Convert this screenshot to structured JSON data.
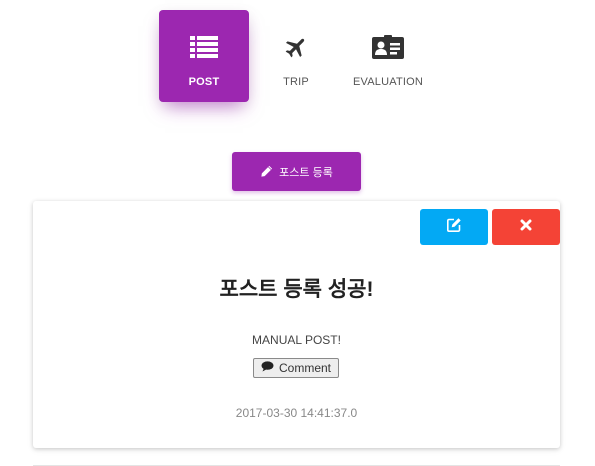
{
  "tabs": [
    {
      "label": "POST",
      "icon": "list-icon",
      "active": true
    },
    {
      "label": "TRIP",
      "icon": "airplane-icon",
      "active": false
    },
    {
      "label": "EVALUATION",
      "icon": "id-card-icon",
      "active": false
    }
  ],
  "register_button": {
    "label": "포스트 등록",
    "icon": "pencil-icon"
  },
  "post": {
    "title": "포스트 등록 성공!",
    "body": "MANUAL POST!",
    "comment_label": "Comment",
    "date": "2017-03-30 14:41:37.0",
    "edit_icon": "edit-icon",
    "delete_icon": "close-icon"
  },
  "colors": {
    "accent": "#9c27b0",
    "edit": "#03a9f4",
    "delete": "#f44336"
  }
}
